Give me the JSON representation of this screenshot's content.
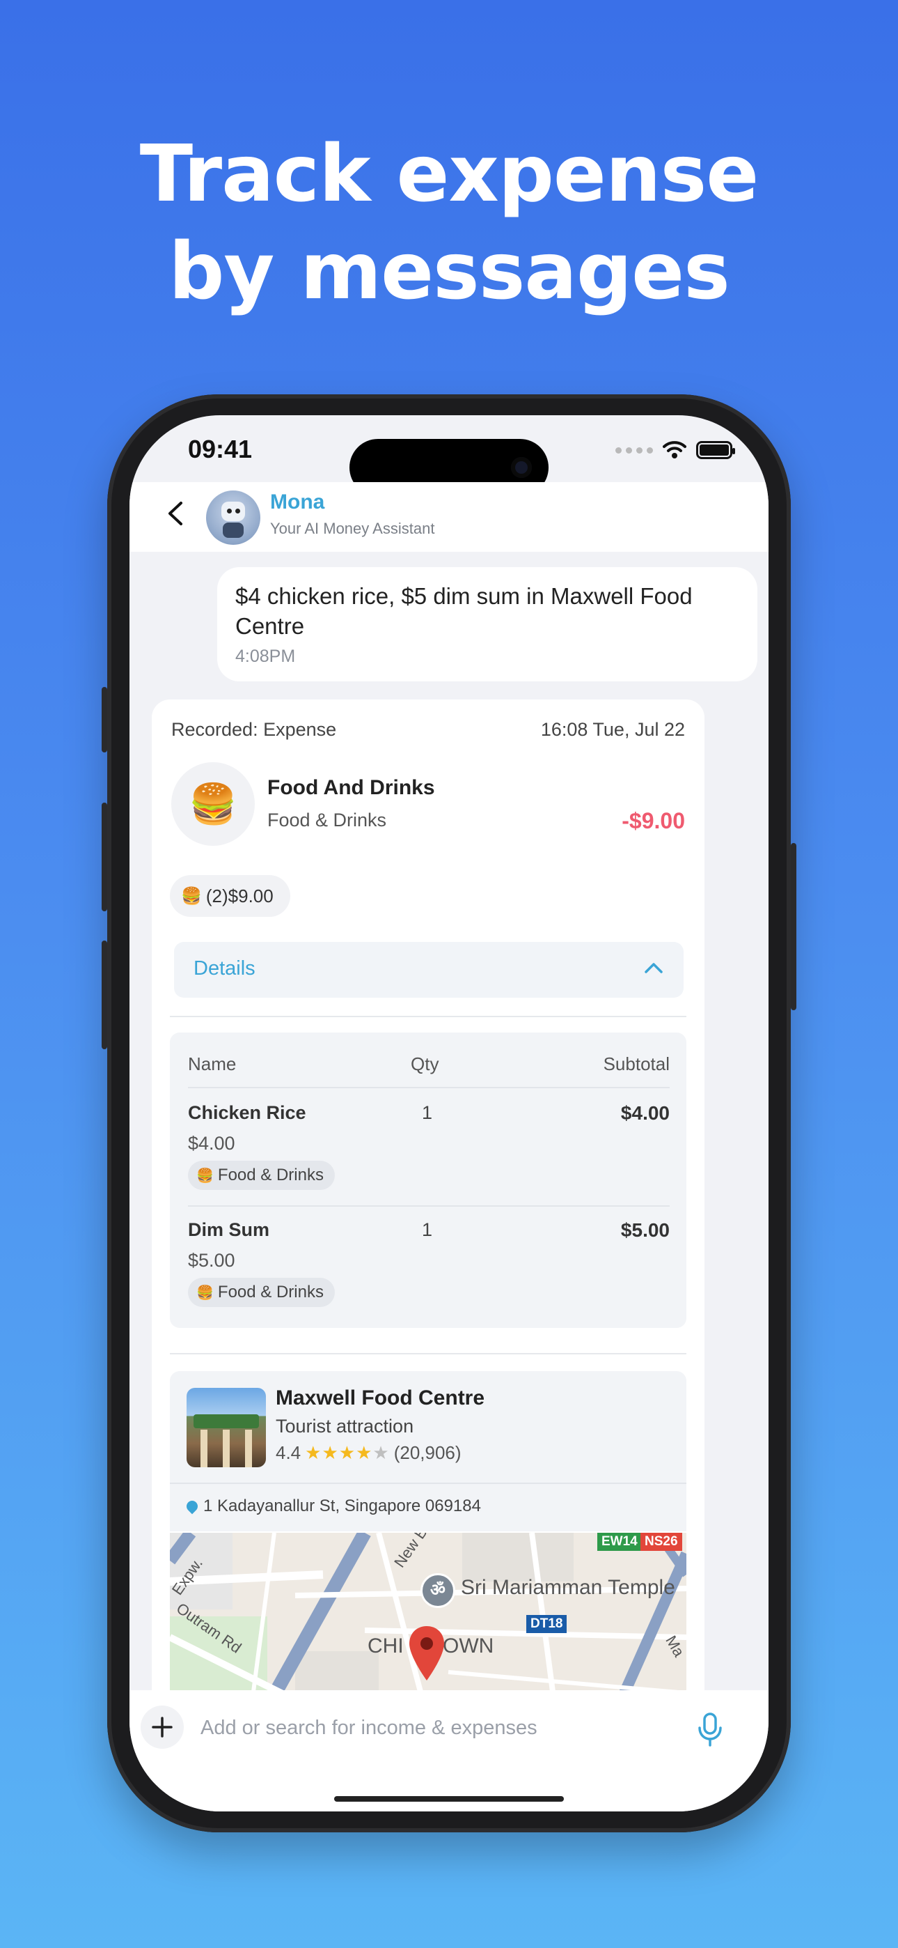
{
  "headline": {
    "line1": "Track expense",
    "line2": "by messages"
  },
  "status": {
    "time": "09:41"
  },
  "header": {
    "name": "Mona",
    "subtitle": "Your AI Money Assistant"
  },
  "user_message": {
    "text": "$4 chicken rice, $5 dim sum in Maxwell Food Centre",
    "time": "4:08PM"
  },
  "expense_card": {
    "recorded_label": "Recorded: Expense",
    "date": "16:08 Tue, Jul 22",
    "category_title": "Food And Drinks",
    "category_sub": "Food & Drinks",
    "amount": "-$9.00",
    "pill": "(2)$9.00",
    "details_label": "Details",
    "columns": {
      "name": "Name",
      "qty": "Qty",
      "subtotal": "Subtotal"
    },
    "items": [
      {
        "name": "Chicken Rice",
        "price": "$4.00",
        "qty": "1",
        "subtotal": "$4.00",
        "tag": "Food & Drinks"
      },
      {
        "name": "Dim Sum",
        "price": "$5.00",
        "qty": "1",
        "subtotal": "$5.00",
        "tag": "Food & Drinks"
      }
    ]
  },
  "place": {
    "name": "Maxwell Food Centre",
    "type": "Tourist attraction",
    "rating": "4.4",
    "reviews": "(20,906)",
    "address": "1 Kadayanallur St, Singapore 069184"
  },
  "map": {
    "labels": {
      "road1": "New B",
      "road2": "Expw.",
      "road3": "Outram Rd",
      "temple": "Sri Mariamman Temple",
      "area_a": "CHI",
      "area_b": "OWN",
      "road4": "Ma"
    },
    "badges": {
      "b1": "EW14",
      "b2": "NS26",
      "b3": "DT18"
    },
    "icons": {
      "temple": "om"
    }
  },
  "input": {
    "placeholder": "Add or search for income & expenses"
  },
  "colors": {
    "accent": "#3aa4d6",
    "amount": "#ef5a6f",
    "star": "#f5b91e"
  }
}
